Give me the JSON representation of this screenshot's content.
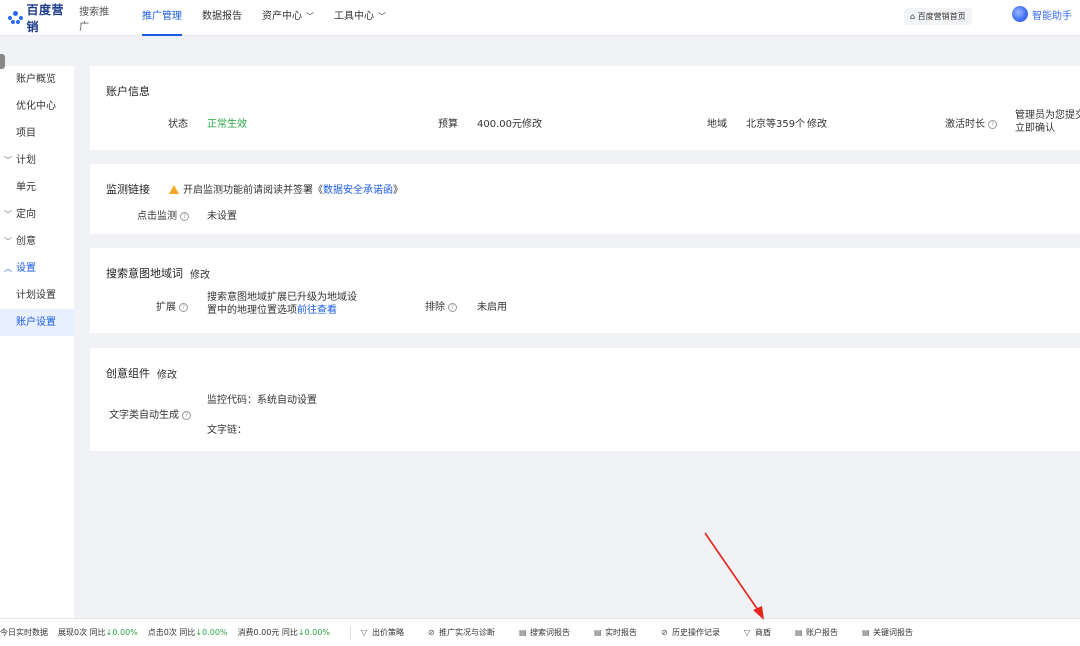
{
  "topnav": {
    "brand": "百度营销",
    "product": "搜索推广",
    "items": [
      {
        "label": "推广管理",
        "active": true,
        "dropdown": false
      },
      {
        "label": "数据报告",
        "active": false,
        "dropdown": false
      },
      {
        "label": "资产中心",
        "active": false,
        "dropdown": true
      },
      {
        "label": "工具中心",
        "active": false,
        "dropdown": true
      }
    ],
    "home_button": "百度营销首页",
    "assistant": "智能助手"
  },
  "sidebar": {
    "items": [
      {
        "label": "账户概览",
        "type": "item"
      },
      {
        "label": "优化中心",
        "type": "item"
      },
      {
        "label": "项目",
        "type": "item"
      },
      {
        "label": "计划",
        "type": "group",
        "caret": "﹀"
      },
      {
        "label": "单元",
        "type": "item"
      },
      {
        "label": "定向",
        "type": "group",
        "caret": "﹀"
      },
      {
        "label": "创意",
        "type": "group",
        "caret": "﹀"
      },
      {
        "label": "设置",
        "type": "group-open",
        "caret": "︿"
      },
      {
        "label": "计划设置",
        "type": "item"
      },
      {
        "label": "账户设置",
        "type": "active"
      }
    ]
  },
  "account_info": {
    "title": "账户信息",
    "status_label": "状态",
    "status_value": "正常生效",
    "budget_label": "预算",
    "budget_value": "400.00元",
    "budget_edit": "修改",
    "region_label": "地域",
    "region_value": "北京等359个",
    "region_edit": "修改",
    "activation_label": "激活时长",
    "activation_line1": "管理员为您提交",
    "activation_line2": "立即确认"
  },
  "monitor": {
    "title": "监测链接",
    "notice_prefix": "开启监测功能前请阅读并签署《",
    "notice_link": "数据安全承诺函",
    "notice_suffix": "》",
    "click_label": "点击监测",
    "click_value": "未设置"
  },
  "search_intent": {
    "title": "搜索意图地域词",
    "edit": "修改",
    "expand_label": "扩展",
    "expand_line1": "搜索意图地域扩展已升级为地域设",
    "expand_line2": "置中的地理位置选项",
    "expand_link": "前往查看",
    "exclude_label": "排除",
    "exclude_value": "未启用"
  },
  "creative": {
    "title": "创意组件",
    "edit": "修改",
    "auto_label": "文字类自动生成",
    "monitor_code": "监控代码：系统自动设置",
    "text_chain": "文字链："
  },
  "bottombar": {
    "today": "今日实时数据",
    "stats": [
      {
        "label": "展现0次",
        "cmp": "同比",
        "val": "↓0.00%"
      },
      {
        "label": "点击0次",
        "cmp": "同比",
        "val": "↓0.00%"
      },
      {
        "label": "消费0.00元",
        "cmp": "同比",
        "val": "↓0.00%"
      }
    ],
    "tools": [
      {
        "label": "出价策略",
        "icon": "▽"
      },
      {
        "label": "推广实况与诊断",
        "icon": "⊘"
      },
      {
        "label": "搜索词报告",
        "icon": "▤"
      },
      {
        "label": "实时报告",
        "icon": "▤"
      },
      {
        "label": "历史操作记录",
        "icon": "⊘"
      },
      {
        "label": "商盾",
        "icon": "▽"
      },
      {
        "label": "账户报告",
        "icon": "▤"
      },
      {
        "label": "关键词报告",
        "icon": "▤"
      }
    ]
  },
  "colors": {
    "accent": "#1a5ce6",
    "success": "#27a844",
    "warning": "#f5a623",
    "annotation": "#e8231a"
  }
}
